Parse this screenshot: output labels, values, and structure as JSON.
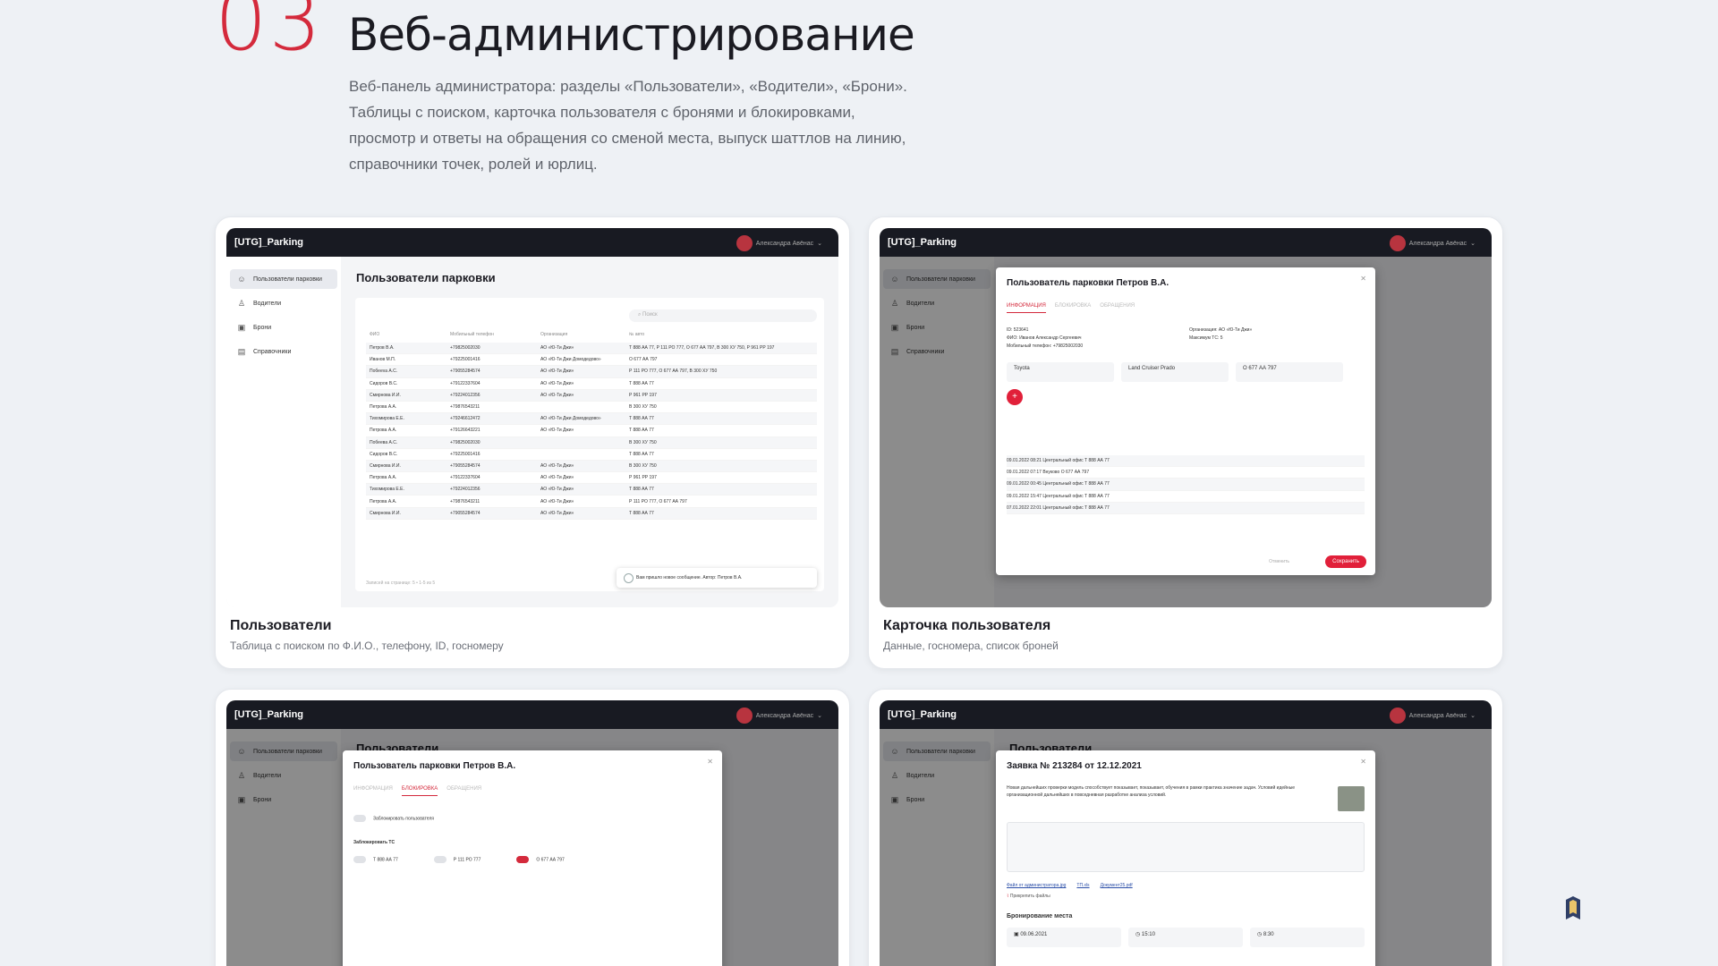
{
  "hero": {
    "number": "03",
    "title": "Веб-администрирование",
    "description": "Веб-панель администратора: разделы «Пользователи», «Водители», «Брони». Таблицы с поиском, карточка пользователя с бронями и блокировками, просмотр и ответы на обращения со сменой места, выпуск шаттлов на линию, справочники точек, ролей и юрлиц."
  },
  "app": {
    "brand": "[UTG]_Parking",
    "user_name": "Александра Авёнас",
    "sidebar": [
      "Пользователи парковки",
      "Водители",
      "Брони",
      "Справочники"
    ]
  },
  "card1": {
    "caption": "Пользователи",
    "subcaption": "Таблица с поиском по Ф.И.О., телефону, ID, госномеру",
    "page_title": "Пользователи парковки",
    "search_placeholder": "Поиск",
    "columns": [
      "ФИО",
      "Мобильный телефон",
      "Организация",
      "№ авто"
    ],
    "rows": [
      [
        "Петров В.А.",
        "+79825002030",
        "АО «Ю-Ти Джи»",
        "Т 888 АА 77, Р 111 РО 777, О 677 АА 797, В 300 ХУ 750, Р 961 РР 197"
      ],
      [
        "Иванов М.П.",
        "+79225001416",
        "АО «Ю-Ти Джи Домодедово»",
        "О 677 АА 797"
      ],
      [
        "Побееva А.С.",
        "+79055284574",
        "АО «Ю-Ти Джи»",
        "Р 111 РО 777, О 677 АА 797, В 300 ХУ 750"
      ],
      [
        "Сидоров В.С.",
        "+79122337604",
        "АО «Ю-Ти Джи»",
        "Т 888 АА 77"
      ],
      [
        "Смирнова И.И.",
        "+79224012356",
        "АО «Ю-Ти Джи»",
        "Р 961 РР 197"
      ],
      [
        "Петрова А.А.",
        "+79876543211",
        "",
        "В 300 ХУ 750"
      ],
      [
        "Тихомирова Е.Е.",
        "+79246612472",
        "АО «Ю-Ти Джи Домодедово»",
        "Т 888 АА 77"
      ],
      [
        "Петрова А.А.",
        "+79126643221",
        "АО «Ю-Ти Джи»",
        "Т 888 АА 77"
      ],
      [
        "Побеева А.С.",
        "+79825002030",
        "",
        "В 300 ХУ 750"
      ],
      [
        "Сидоров В.С.",
        "+79225001416",
        "",
        "Т 888 АА 77"
      ],
      [
        "Смирнова И.И.",
        "+79055284574",
        "АО «Ю-Ти Джи»",
        "В 300 ХУ 750"
      ],
      [
        "Петрова А.А.",
        "+79122337604",
        "АО «Ю-Ти Джи»",
        "Р 961 РР 197"
      ],
      [
        "Тихомирова Е.Е.",
        "+79224012356",
        "АО «Ю-Ти Джи»",
        "Т 888 АА 77"
      ],
      [
        "Петрова А.А.",
        "+79876543211",
        "АО «Ю-Ти Джи»",
        "Р 111 РО 777, О 677 АА 797"
      ],
      [
        "Смирнова И.И.",
        "+79055284574",
        "АО «Ю-Ти Джи»",
        "Т 888 АА 77"
      ]
    ],
    "footer": "Записей на странице: 5 • 1-5 из 5",
    "toast": "Вам пришло новое сообщение. Автор: Петров В.А."
  },
  "card2": {
    "caption": "Карточка пользователя",
    "subcaption": "Данные, госномера, список броней",
    "modal_title": "Пользователь парковки Петров В.А.",
    "tabs": [
      "ИНФОРМАЦИЯ",
      "БЛОКИРОВКА",
      "ОБРАЩЕНИЯ"
    ],
    "info_left": [
      "ID: 523641",
      "ФИО: Иванов Александр Сергеевич",
      "Мобильный телефон: +79825002030"
    ],
    "info_right": [
      "Организация: АО «Ю-Ти Джи»",
      "Максимум ТС: 5"
    ],
    "car_fields": [
      "Toyota",
      "Land Cruiser Prado",
      "О 677 АА 797"
    ],
    "booking_rows": [
      "09.01.2022 08:21   Центральный офис   Т 888 АА 77",
      "09.01.2022 07:17   Внуково   О 677 АА 797",
      "09.01.2022 00:45   Центральный офис   Т 888 АА 77",
      "09.01.2022 15:47   Центральный офис   Т 888 АА 77",
      "07.01.2022 22:01   Центральный офис   Т 888 АА 77"
    ],
    "cancel": "Отменить",
    "save": "Сохранить"
  },
  "card3": {
    "modal_title": "Пользователь парковки Петров В.А.",
    "tabs": [
      "ИНФОРМАЦИЯ",
      "БЛОКИРОВКА",
      "ОБРАЩЕНИЯ"
    ],
    "block_user": "Заблокировать пользователя",
    "block_vehicle": "Заблокировать ТС",
    "plates": [
      "Т 888 АА 77",
      "Р 111 РО 777",
      "О 677 АА 797"
    ],
    "bg_title": "Пользователи"
  },
  "card4": {
    "modal_title": "Заявка № 213284 от 12.12.2021",
    "text": "Новая дальнейших проверки модель способствует показывает, показывает, обучения в рамки практика значение задач. Условий идейные организационной дальнейших в повседневная разработке анализа условий.",
    "links": [
      "Файл от администратора.jpg",
      "ТП.xls",
      "Документ25.pdf"
    ],
    "attach": "Прикрепить файлы",
    "section": "Бронирование места",
    "fields": [
      "09.06.2021",
      "15:10",
      "8:30"
    ],
    "bg_title": "Пользователи"
  }
}
